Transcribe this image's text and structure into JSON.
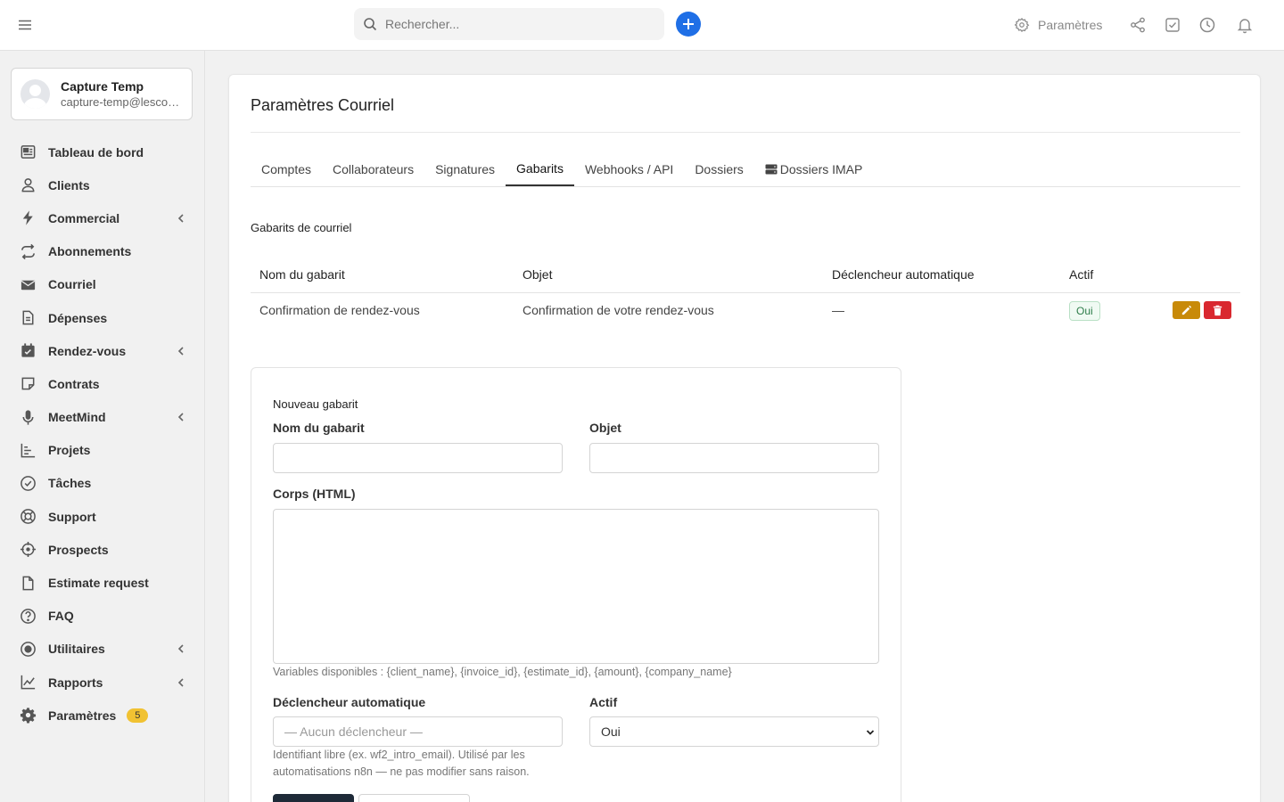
{
  "topbar": {
    "search_placeholder": "Rechercher...",
    "settings_label": "Paramètres"
  },
  "user": {
    "name": "Capture Temp",
    "email": "capture-temp@lescoursdelevenement.com"
  },
  "sidebar": {
    "items": [
      {
        "label": "Tableau de bord",
        "icon": "dashboard-icon"
      },
      {
        "label": "Clients",
        "icon": "user-icon"
      },
      {
        "label": "Commercial",
        "icon": "bolt-icon"
      },
      {
        "label": "Abonnements",
        "icon": "repeat-icon"
      },
      {
        "label": "Courriel",
        "icon": "envelope-icon"
      },
      {
        "label": "Dépenses",
        "icon": "file-text-icon"
      },
      {
        "label": "Rendez-vous",
        "icon": "calendar-icon"
      },
      {
        "label": "Contrats",
        "icon": "note-icon"
      },
      {
        "label": "MeetMind",
        "icon": "microphone-icon"
      },
      {
        "label": "Projets",
        "icon": "bar-chart-icon"
      },
      {
        "label": "Tâches",
        "icon": "check-circle-icon"
      },
      {
        "label": "Support",
        "icon": "lifebuoy-icon"
      },
      {
        "label": "Prospects",
        "icon": "crosshair-icon"
      },
      {
        "label": "Estimate request",
        "icon": "file-icon"
      },
      {
        "label": "FAQ",
        "icon": "question-circle-icon"
      },
      {
        "label": "Utilitaires",
        "icon": "dot-circle-icon"
      },
      {
        "label": "Rapports",
        "icon": "line-chart-icon"
      },
      {
        "label": "Paramètres",
        "icon": "gear-icon",
        "badge": "5"
      }
    ]
  },
  "page": {
    "title": "Paramètres Courriel",
    "tabs": [
      "Comptes",
      "Collaborateurs",
      "Signatures",
      "Gabarits",
      "Webhooks / API",
      "Dossiers",
      "Dossiers IMAP"
    ],
    "active_tab": "Gabarits"
  },
  "templates": {
    "section_title": "Gabarits de courriel",
    "columns": [
      "Nom du gabarit",
      "Objet",
      "Déclencheur automatique",
      "Actif"
    ],
    "rows": [
      {
        "name": "Confirmation de rendez-vous",
        "subject": "Confirmation de votre rendez-vous",
        "trigger": "—",
        "active": "Oui"
      }
    ]
  },
  "form": {
    "title": "Nouveau gabarit",
    "name_label": "Nom du gabarit",
    "subject_label": "Objet",
    "body_label": "Corps (HTML)",
    "variables_help": "Variables disponibles : {client_name}, {invoice_id}, {estimate_id}, {amount}, {company_name}",
    "trigger_label": "Déclencheur automatique",
    "trigger_placeholder": "— Aucun déclencheur —",
    "trigger_help_line1": "Identifiant libre (ex. wf2_intro_email). Utilisé par les",
    "trigger_help_line2": "automatisations n8n — ne pas modifier sans raison.",
    "active_label": "Actif",
    "active_value": "Oui"
  },
  "colors": {
    "primary": "#1f6fe6",
    "edit": "#c88a09",
    "delete": "#d9282f",
    "badge": "#f1c232",
    "success": "#2e7d4a"
  }
}
